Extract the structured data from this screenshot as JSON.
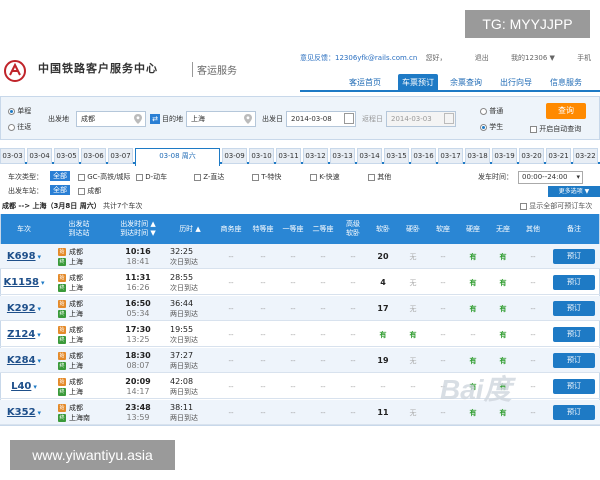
{
  "watermarks": {
    "top": "TG: MYYJJPP",
    "bottom": "www.yiwantiyu.asia"
  },
  "header": {
    "title": "中国铁路客户服务中心",
    "subtitle": "客运服务",
    "feedback": "意见反馈：12306yfk@rails.com.cn",
    "hello": "您好，",
    "logout": "退出",
    "my12306": "我的12306 ▼",
    "mobile": "手机",
    "nav": [
      "客运首页",
      "车票预订",
      "余票查询",
      "出行向导",
      "信息服务"
    ],
    "nav_active": 1
  },
  "search": {
    "trip_oneway": "单程",
    "trip_round": "往返",
    "from_label": "出发地",
    "from_value": "成都",
    "to_label": "目的地",
    "to_value": "上海",
    "date_label": "出发日",
    "date_value": "2014-03-08",
    "return_label": "返程日",
    "return_value": "2014-03-03",
    "pax_normal": "普通",
    "pax_student": "学生",
    "query_btn": "查询",
    "auto_query": "开启自动查询"
  },
  "date_tabs": [
    "03-03",
    "03-04",
    "03-05",
    "03-06",
    "03-07",
    "03-08 周六",
    "03-09",
    "03-10",
    "03-11",
    "03-12",
    "03-13",
    "03-14",
    "03-15",
    "03-16",
    "03-17",
    "03-18",
    "03-19",
    "03-20",
    "03-21",
    "03-22"
  ],
  "date_tab_active": 5,
  "filters": {
    "type_label": "车次类型：",
    "all": "全部",
    "types": [
      "GC-高铁/城际",
      "D-动车",
      "Z-直达",
      "T-特快",
      "K-快速",
      "其他"
    ],
    "station_label": "出发车站：",
    "station_all": "全部",
    "station": "成都",
    "time_label": "发车时间：",
    "time_value": "00:00--24:00",
    "more": "更多选项 ▼"
  },
  "route": {
    "text": "成都 --> 上海（3月8日 周六）",
    "count": "共计7个车次",
    "show_all": "显示全部可预订车次"
  },
  "table": {
    "headers": {
      "train": "车次",
      "station": "出发站\n到达站",
      "times": "出发时间 ▲\n到达时间 ▼",
      "duration": "历时 ▲",
      "shangwu": "商务座",
      "tedeng": "特等座",
      "yideng": "一等座",
      "erdeng": "二等座",
      "gaoruan": "高级\n软卧",
      "ruanwo": "软卧",
      "yingwo": "硬卧",
      "ruanzuo": "软座",
      "yingzuo": "硬座",
      "wuzuo": "无座",
      "qita": "其他",
      "beizhu": "备注"
    },
    "book_label": "预订",
    "rows": [
      {
        "train": "K698",
        "from": "成都",
        "to": "上海",
        "dep": "10:16",
        "arr": "18:41",
        "dur": "32:25",
        "dur2": "次日到达",
        "seats": [
          "--",
          "--",
          "--",
          "--",
          "--",
          "20",
          "无",
          "--",
          "有",
          "有",
          "--"
        ]
      },
      {
        "train": "K1158",
        "from": "成都",
        "to": "上海",
        "dep": "11:31",
        "arr": "16:26",
        "dur": "28:55",
        "dur2": "次日到达",
        "seats": [
          "--",
          "--",
          "--",
          "--",
          "--",
          "4",
          "无",
          "--",
          "有",
          "有",
          "--"
        ]
      },
      {
        "train": "K292",
        "from": "成都",
        "to": "上海",
        "dep": "16:50",
        "arr": "05:34",
        "dur": "36:44",
        "dur2": "两日到达",
        "seats": [
          "--",
          "--",
          "--",
          "--",
          "--",
          "17",
          "无",
          "--",
          "有",
          "有",
          "--"
        ]
      },
      {
        "train": "Z124",
        "from": "成都",
        "to": "上海",
        "dep": "17:30",
        "arr": "13:25",
        "dur": "19:55",
        "dur2": "次日到达",
        "seats": [
          "--",
          "--",
          "--",
          "--",
          "--",
          "有",
          "有",
          "--",
          "--",
          "有",
          "--"
        ]
      },
      {
        "train": "K284",
        "from": "成都",
        "to": "上海",
        "dep": "18:30",
        "arr": "08:07",
        "dur": "37:27",
        "dur2": "两日到达",
        "seats": [
          "--",
          "--",
          "--",
          "--",
          "--",
          "19",
          "无",
          "--",
          "有",
          "有",
          "--"
        ]
      },
      {
        "train": "L40",
        "from": "成都",
        "to": "上海",
        "dep": "20:09",
        "arr": "14:17",
        "dur": "42:08",
        "dur2": "两日到达",
        "seats": [
          "--",
          "--",
          "--",
          "--",
          "--",
          "--",
          "--",
          "--",
          "有",
          "有",
          "--"
        ]
      },
      {
        "train": "K352",
        "from": "成都",
        "to": "上海南",
        "dep": "23:48",
        "arr": "13:59",
        "dur": "38:11",
        "dur2": "两日到达",
        "seats": [
          "--",
          "--",
          "--",
          "--",
          "--",
          "11",
          "无",
          "--",
          "有",
          "有",
          "--"
        ]
      }
    ]
  },
  "baidu_mark": "Bai度"
}
